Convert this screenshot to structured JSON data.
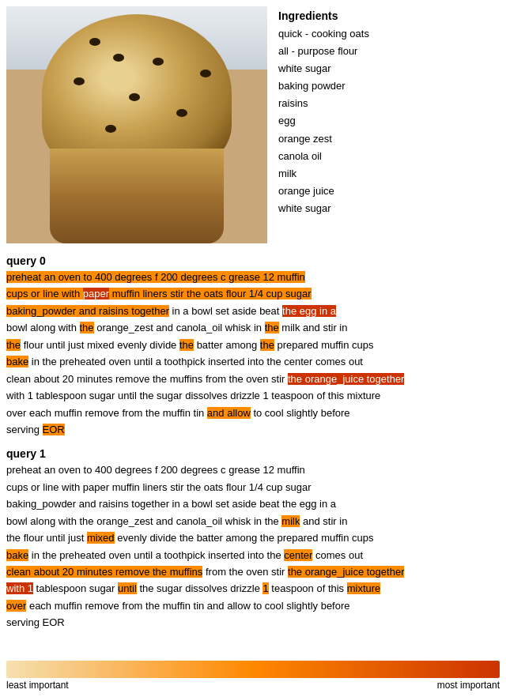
{
  "image": {
    "alt": "oat muffin with raisins"
  },
  "ingredients": {
    "title": "Ingredients",
    "items": [
      "quick - cooking oats",
      "all - purpose flour",
      "white sugar",
      "baking powder",
      "raisins",
      "egg",
      "orange zest",
      "canola oil",
      "milk",
      "orange juice",
      "white sugar"
    ]
  },
  "query0": {
    "title": "query 0",
    "segments": [
      {
        "text": "preheat an oven to 400 degrees f 200 degrees c grease 12 muffin",
        "hl": "orange"
      },
      {
        "text": " cups or line with ",
        "hl": "orange"
      },
      {
        "text": "paper",
        "hl": "dark-orange"
      },
      {
        "text": " muffin liners stir the oats flour 1/4 cup sugar",
        "hl": "orange"
      },
      {
        "text": "\nbaking_powder and raisins together",
        "hl": "orange"
      },
      {
        "text": " in a bowl set aside beat ",
        "hl": "none"
      },
      {
        "text": "the egg in a",
        "hl": "dark-orange"
      },
      {
        "text": "\nbowl along with ",
        "hl": "none"
      },
      {
        "text": "the",
        "hl": "orange"
      },
      {
        "text": " orange_zest and canola_oil whisk in ",
        "hl": "none"
      },
      {
        "text": "the",
        "hl": "orange"
      },
      {
        "text": " milk and stir in",
        "hl": "none"
      },
      {
        "text": "\n"
      },
      {
        "text": "the",
        "hl": "orange"
      },
      {
        "text": " flour until just mixed evenly divide ",
        "hl": "none"
      },
      {
        "text": "the",
        "hl": "orange"
      },
      {
        "text": " batter among ",
        "hl": "none"
      },
      {
        "text": "the",
        "hl": "orange"
      },
      {
        "text": " prepared muffin cups",
        "hl": "none"
      },
      {
        "text": "\n"
      },
      {
        "text": "bake",
        "hl": "orange"
      },
      {
        "text": " in the preheated oven until a toothpick inserted into the center comes out",
        "hl": "none"
      },
      {
        "text": "\nclean about 20 minutes remove the muffins from the oven stir ",
        "hl": "none"
      },
      {
        "text": "the orange_juice together",
        "hl": "dark-orange"
      },
      {
        "text": "\n"
      },
      {
        "text": "with",
        "hl": "none"
      },
      {
        "text": " 1 tablespoon sugar until the sugar dissolves drizzle 1 teaspoon of this mixture",
        "hl": "none"
      },
      {
        "text": "\nover each muffin remove from the muffin tin ",
        "hl": "none"
      },
      {
        "text": "and allow",
        "hl": "orange"
      },
      {
        "text": " to cool slightly before",
        "hl": "none"
      },
      {
        "text": "\nserving ",
        "hl": "none"
      },
      {
        "text": "EOR",
        "hl": "orange"
      }
    ]
  },
  "query1": {
    "title": "query 1",
    "segments": [
      {
        "text": "preheat an oven to 400 degrees f 200 degrees c grease 12 muffin",
        "hl": "none"
      },
      {
        "text": "\ncups or line with paper muffin liners stir the oats flour 1/4 cup sugar",
        "hl": "none"
      },
      {
        "text": "\nbaking_powder and raisins together in a bowl set aside beat the egg in a",
        "hl": "none"
      },
      {
        "text": "\nbowl along with the orange_zest and canola_oil whisk in the ",
        "hl": "none"
      },
      {
        "text": "milk",
        "hl": "orange"
      },
      {
        "text": " and stir in",
        "hl": "none"
      },
      {
        "text": "\nthe flour until just ",
        "hl": "none"
      },
      {
        "text": "mixed",
        "hl": "orange"
      },
      {
        "text": " evenly divide the batter among the prepared muffin cups",
        "hl": "none"
      },
      {
        "text": "\n"
      },
      {
        "text": "bake",
        "hl": "orange"
      },
      {
        "text": " in the preheated oven until a toothpick inserted into the ",
        "hl": "none"
      },
      {
        "text": "center",
        "hl": "orange"
      },
      {
        "text": " comes out",
        "hl": "none"
      },
      {
        "text": "\n"
      },
      {
        "text": "clean about 20 minutes remove the muffins",
        "hl": "orange"
      },
      {
        "text": " from the oven stir ",
        "hl": "none"
      },
      {
        "text": "the orange_juice together",
        "hl": "orange"
      },
      {
        "text": "\n"
      },
      {
        "text": "with 1",
        "hl": "dark-orange"
      },
      {
        "text": " tablespoon sugar ",
        "hl": "none"
      },
      {
        "text": "until",
        "hl": "orange"
      },
      {
        "text": " the sugar dissolves drizzle ",
        "hl": "none"
      },
      {
        "text": "1",
        "hl": "orange"
      },
      {
        "text": " teaspoon of this ",
        "hl": "none"
      },
      {
        "text": "mixture",
        "hl": "orange"
      },
      {
        "text": "\n"
      },
      {
        "text": "over",
        "hl": "orange"
      },
      {
        "text": " each muffin remove from the muffin tin and allow to cool slight",
        "hl": "none"
      },
      {
        "text": "ly",
        "hl": "none"
      },
      {
        "text": " before",
        "hl": "none"
      },
      {
        "text": "\nserving EOR",
        "hl": "none"
      }
    ]
  },
  "gradient": {
    "left_label": "least important",
    "right_label": "most important"
  }
}
